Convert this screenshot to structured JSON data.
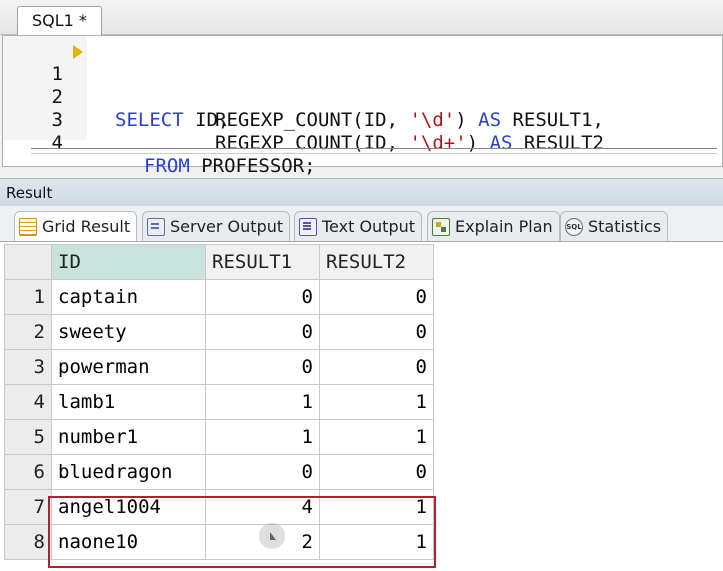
{
  "editor": {
    "tab_title": "SQL1 *",
    "line_numbers": [
      "1",
      "2",
      "3",
      "4"
    ],
    "code": {
      "l1_kw1": "SELECT",
      "l1_t1": " ID,",
      "l2_t1": "REGEXP_COUNT(ID, ",
      "l2_str": "'\\d'",
      "l2_t2": ") ",
      "l2_kw": "AS",
      "l2_t3": " RESULT1,",
      "l3_t1": "REGEXP_COUNT(ID, ",
      "l3_str": "'\\d+'",
      "l3_t2": ") ",
      "l3_kw": "AS",
      "l3_t3": " RESULT2",
      "l4_kw": "FROM",
      "l4_t1": " PROFESSOR;"
    }
  },
  "result": {
    "header": "Result",
    "tabs": [
      {
        "label": "Grid Result",
        "icon": "grid-icon"
      },
      {
        "label": "Server Output",
        "icon": "server-icon"
      },
      {
        "label": "Text Output",
        "icon": "text-icon"
      },
      {
        "label": "Explain Plan",
        "icon": "plan-icon"
      },
      {
        "label": "Statistics",
        "icon": "statistics-icon"
      }
    ],
    "columns": [
      "ID",
      "RESULT1",
      "RESULT2"
    ],
    "rows": [
      {
        "n": "1",
        "id": "captain",
        "r1": "0",
        "r2": "0"
      },
      {
        "n": "2",
        "id": "sweety",
        "r1": "0",
        "r2": "0"
      },
      {
        "n": "3",
        "id": "powerman",
        "r1": "0",
        "r2": "0"
      },
      {
        "n": "4",
        "id": "lamb1",
        "r1": "1",
        "r2": "1"
      },
      {
        "n": "5",
        "id": "number1",
        "r1": "1",
        "r2": "1"
      },
      {
        "n": "6",
        "id": "bluedragon",
        "r1": "0",
        "r2": "0"
      },
      {
        "n": "7",
        "id": "angel1004",
        "r1": "4",
        "r2": "1"
      },
      {
        "n": "8",
        "id": "naone10",
        "r1": "2",
        "r2": "1"
      }
    ]
  },
  "colors": {
    "keyword": "#2b3fd2",
    "string": "#b01414",
    "highlight_border": "#b3202c",
    "selected_header": "#c7e3dc"
  }
}
